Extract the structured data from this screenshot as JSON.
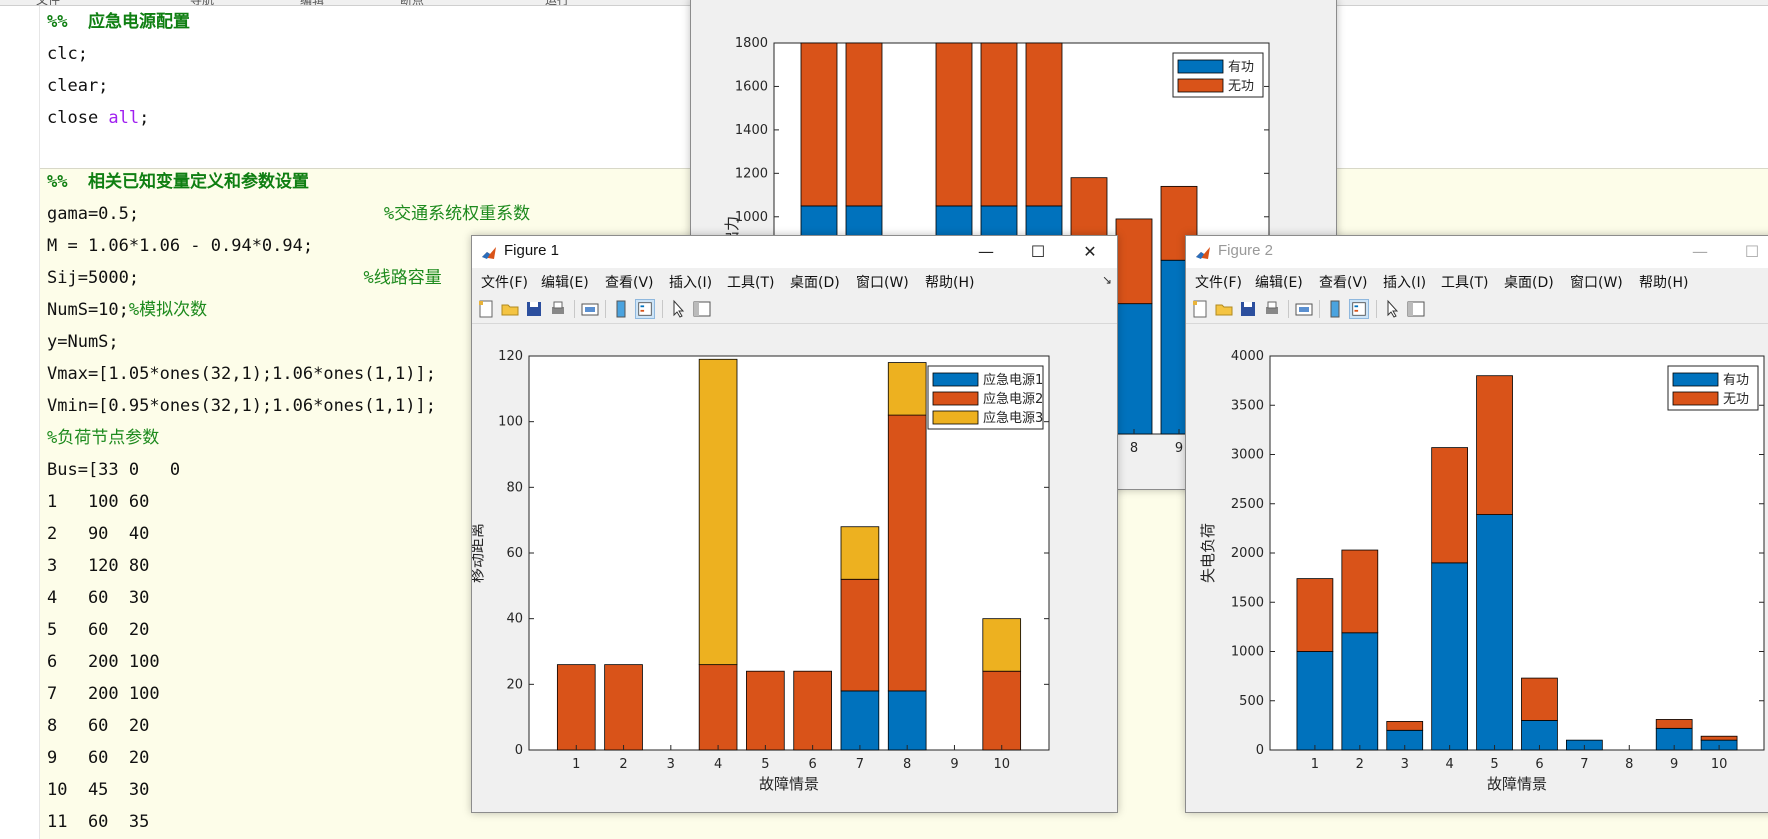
{
  "editor": {
    "top_labels": [
      "文件",
      "导航",
      "编辑",
      "断点",
      "运行"
    ],
    "lines": [
      {
        "code": "%%  应急电源配置",
        "comment": "",
        "type": "section"
      },
      {
        "code": "clc;",
        "comment": "",
        "type": "code"
      },
      {
        "code": "clear;",
        "comment": "",
        "type": "code"
      },
      {
        "code": "close ",
        "kw": "all",
        "tail": ";",
        "comment": "",
        "type": "kwline"
      },
      {
        "code": "",
        "comment": "",
        "type": "code"
      },
      {
        "code": "%%  相关已知变量定义和参数设置",
        "comment": "",
        "type": "section"
      },
      {
        "code": "gama=0.5;",
        "comment": "%交通系统权重系数",
        "pad": 33,
        "type": "code"
      },
      {
        "code": "M = 1.06*1.06 - 0.94*0.94;",
        "comment": "",
        "type": "code"
      },
      {
        "code": "Sij=5000;",
        "comment": "%线路容量",
        "pad": 31,
        "type": "code"
      },
      {
        "code": "NumS=10;",
        "comment": "%模拟次数",
        "type": "code"
      },
      {
        "code": "y=NumS;",
        "comment": "",
        "type": "code"
      },
      {
        "code": "Vmax=[1.05*ones(32,1);1.06*ones(1,1)];",
        "comment": "",
        "type": "code"
      },
      {
        "code": "Vmin=[0.95*ones(32,1);1.06*ones(1,1)];",
        "comment": "",
        "type": "code"
      },
      {
        "code": "",
        "comment": "%负荷节点参数",
        "type": "code"
      },
      {
        "code": "Bus=[33 0   0",
        "comment": "",
        "type": "code"
      },
      {
        "code": "1   100 60",
        "comment": "",
        "type": "code"
      },
      {
        "code": "2   90  40",
        "comment": "",
        "type": "code"
      },
      {
        "code": "3   120 80",
        "comment": "",
        "type": "code"
      },
      {
        "code": "4   60  30",
        "comment": "",
        "type": "code"
      },
      {
        "code": "5   60  20",
        "comment": "",
        "type": "code"
      },
      {
        "code": "6   200 100",
        "comment": "",
        "type": "code"
      },
      {
        "code": "7   200 100",
        "comment": "",
        "type": "code"
      },
      {
        "code": "8   60  20",
        "comment": "",
        "type": "code"
      },
      {
        "code": "9   60  20",
        "comment": "",
        "type": "code"
      },
      {
        "code": "10  45  30",
        "comment": "",
        "type": "code"
      },
      {
        "code": "11  60  35",
        "comment": "",
        "type": "code"
      }
    ]
  },
  "menus": [
    "文件(F)",
    "编辑(E)",
    "查看(V)",
    "插入(I)",
    "工具(T)",
    "桌面(D)",
    "窗口(W)",
    "帮助(H)"
  ],
  "window_buttons": {
    "minimize": "—",
    "maximize": "☐",
    "close": "✕"
  },
  "figure1": {
    "title": "Figure 1"
  },
  "figure2": {
    "title": "Figure 2"
  },
  "colors": {
    "blue": "#0072BD",
    "orange": "#D95319",
    "yellow": "#EDB120"
  },
  "chart_data": [
    {
      "id": "figure1",
      "type": "bar",
      "stacked": true,
      "categories": [
        "1",
        "2",
        "3",
        "4",
        "5",
        "6",
        "7",
        "8",
        "9",
        "10"
      ],
      "series": [
        {
          "name": "应急电源1",
          "values": [
            0,
            0,
            0,
            0,
            0,
            0,
            18,
            18,
            0,
            0
          ]
        },
        {
          "name": "应急电源2",
          "values": [
            26,
            26,
            0,
            26,
            24,
            24,
            34,
            84,
            0,
            24
          ]
        },
        {
          "name": "应急电源3",
          "values": [
            0,
            0,
            0,
            93,
            0,
            0,
            16,
            16,
            0,
            16
          ]
        }
      ],
      "xlabel": "故障情景",
      "ylabel": "移动距离",
      "ylim": [
        0,
        120
      ],
      "yticks": [
        0,
        20,
        40,
        60,
        80,
        100,
        120
      ],
      "legend_position": "top-right"
    },
    {
      "id": "figure2",
      "type": "bar",
      "stacked": true,
      "categories": [
        "1",
        "2",
        "3",
        "4",
        "5",
        "6",
        "7",
        "8",
        "9",
        "10"
      ],
      "series": [
        {
          "name": "有功",
          "values": [
            1000,
            1190,
            200,
            1900,
            2390,
            300,
            100,
            0,
            220,
            100
          ]
        },
        {
          "name": "无功",
          "values": [
            740,
            840,
            90,
            1170,
            1410,
            430,
            0,
            0,
            90,
            40
          ]
        }
      ],
      "xlabel": "故障情景",
      "ylabel": "失电负荷",
      "ylim": [
        0,
        4000
      ],
      "yticks": [
        0,
        500,
        1000,
        1500,
        2000,
        2500,
        3000,
        3500,
        4000
      ],
      "legend_position": "top-right"
    },
    {
      "id": "figure_back",
      "type": "bar",
      "stacked": true,
      "categories": [
        "1",
        "2",
        "3",
        "4",
        "5",
        "6",
        "7",
        "8",
        "9",
        "10"
      ],
      "series": [
        {
          "name": "有功",
          "values": [
            1050,
            1050,
            0,
            1050,
            1050,
            1050,
            600,
            600,
            800,
            0
          ]
        },
        {
          "name": "无功",
          "values": [
            750,
            750,
            0,
            750,
            750,
            750,
            580,
            390,
            340,
            0
          ]
        }
      ],
      "ylabel": "总出力",
      "ylim": [
        0,
        1800
      ],
      "yticks": [
        1000,
        1200,
        1400,
        1600,
        1800
      ],
      "xticks_visible": [
        "8",
        "9"
      ],
      "legend_position": "top-right"
    }
  ]
}
